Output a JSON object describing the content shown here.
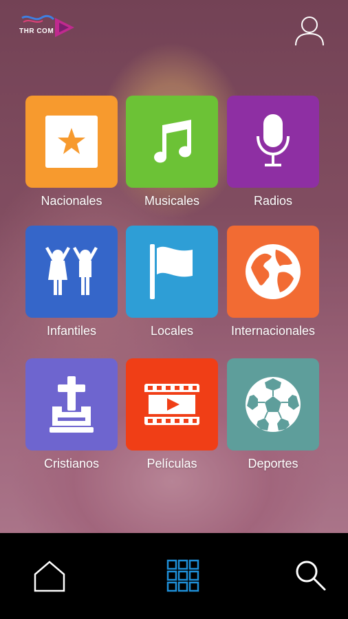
{
  "header": {
    "logo_text": "THR COM",
    "logo_icon": "throttle-play-logo",
    "profile_icon": "user-icon"
  },
  "categories": [
    {
      "label": "Nacionales",
      "icon": "star-icon",
      "color": "#F79A2E"
    },
    {
      "label": "Musicales",
      "icon": "music-note-icon",
      "color": "#6CC236"
    },
    {
      "label": "Radios",
      "icon": "microphone-icon",
      "color": "#8E2FA3"
    },
    {
      "label": "Infantiles",
      "icon": "children-icon",
      "color": "#3566C9"
    },
    {
      "label": "Locales",
      "icon": "flag-icon",
      "color": "#2E9ED6"
    },
    {
      "label": "Internacionales",
      "icon": "globe-icon",
      "color": "#F26B33"
    },
    {
      "label": "Cristianos",
      "icon": "bible-cross-icon",
      "color": "#6E65CF"
    },
    {
      "label": "Películas",
      "icon": "film-strip-icon",
      "color": "#F03E16"
    },
    {
      "label": "Deportes",
      "icon": "soccer-ball-icon",
      "color": "#5E9E9B"
    }
  ],
  "bottom_nav": {
    "items": [
      {
        "name": "home",
        "icon": "home-icon",
        "color": "#FFFFFF"
      },
      {
        "name": "categories",
        "icon": "grid-icon",
        "color": "#1E8FD8",
        "active": true
      },
      {
        "name": "search",
        "icon": "search-icon",
        "color": "#FFFFFF"
      }
    ]
  }
}
